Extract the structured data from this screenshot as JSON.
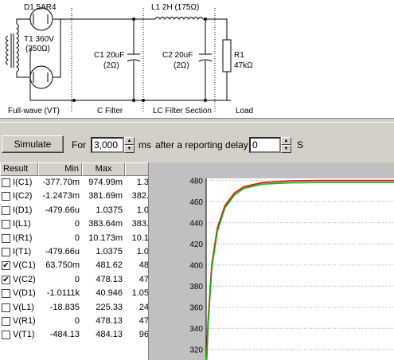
{
  "schematic": {
    "d1_label": "D1  5AR4",
    "t1_label": "T1 360V",
    "t1_res": "(350Ω)",
    "l1_label": "L1 2H (175Ω)",
    "c1_label": "C1 20uF",
    "c1_res": "(2Ω)",
    "c2_label": "C2 20uF",
    "c2_res": "(2Ω)",
    "r1_label": "R1",
    "r1_value": "47kΩ",
    "section_fullwave": "Full-wave (VT)",
    "section_cfilter": "C Filter",
    "section_lcfilter": "LC Filter Section",
    "section_load": "Load"
  },
  "toolbar": {
    "simulate_label": "Simulate",
    "for_label": "For",
    "duration_value": "3,000",
    "ms_label": "ms",
    "delay_label": "after a reporting delay of",
    "delay_value": "0",
    "s_label": "S"
  },
  "results": {
    "headers": [
      "Result",
      "Min",
      "Max",
      ""
    ],
    "rows": [
      {
        "name": "I(C1)",
        "checked": false,
        "min": "-377.70m",
        "max": "974.99m",
        "extra": "1.3"
      },
      {
        "name": "I(C2)",
        "checked": false,
        "min": "-1.2473m",
        "max": "381.69m",
        "extra": "382."
      },
      {
        "name": "I(D1)",
        "checked": false,
        "min": "-479.66u",
        "max": "1.0375",
        "extra": "1.0"
      },
      {
        "name": "I(L1)",
        "checked": false,
        "min": "0",
        "max": "383.64m",
        "extra": "383."
      },
      {
        "name": "I(R1)",
        "checked": false,
        "min": "0",
        "max": "10.173m",
        "extra": "10.1"
      },
      {
        "name": "I(T1)",
        "checked": false,
        "min": "-479.66u",
        "max": "1.0375",
        "extra": "1.0"
      },
      {
        "name": "V(C1)",
        "checked": true,
        "min": "63.750m",
        "max": "481.62",
        "extra": "48"
      },
      {
        "name": "V(C2)",
        "checked": true,
        "min": "0",
        "max": "478.13",
        "extra": "47"
      },
      {
        "name": "V(D1)",
        "checked": false,
        "min": "-1.0111k",
        "max": "40.946",
        "extra": "1.05"
      },
      {
        "name": "V(L1)",
        "checked": false,
        "min": "-18.835",
        "max": "225.33",
        "extra": "24"
      },
      {
        "name": "V(R1)",
        "checked": false,
        "min": "0",
        "max": "478.13",
        "extra": "47"
      },
      {
        "name": "V(T1)",
        "checked": false,
        "min": "-484.13",
        "max": "484.13",
        "extra": "96"
      }
    ]
  },
  "chart_data": {
    "type": "line",
    "yticks": [
      "480",
      "460",
      "440",
      "420",
      "400",
      "380",
      "360",
      "340",
      "320"
    ],
    "ylim": [
      310,
      482
    ],
    "series": [
      {
        "color": "#e02020",
        "x": [
          0,
          0.01,
          0.03,
          0.06,
          0.1,
          0.15,
          0.2,
          0.3,
          0.45,
          0.6,
          0.8,
          1.0
        ],
        "values": [
          300,
          345,
          400,
          435,
          456,
          468,
          474,
          478,
          479.5,
          480,
          480,
          480
        ]
      },
      {
        "color": "#00c000",
        "x": [
          0,
          0.01,
          0.03,
          0.06,
          0.1,
          0.15,
          0.2,
          0.3,
          0.45,
          0.6,
          0.8,
          1.0
        ],
        "values": [
          300,
          342,
          397,
          432,
          454,
          466,
          472.5,
          476.5,
          477.8,
          478,
          478,
          478
        ]
      }
    ]
  }
}
